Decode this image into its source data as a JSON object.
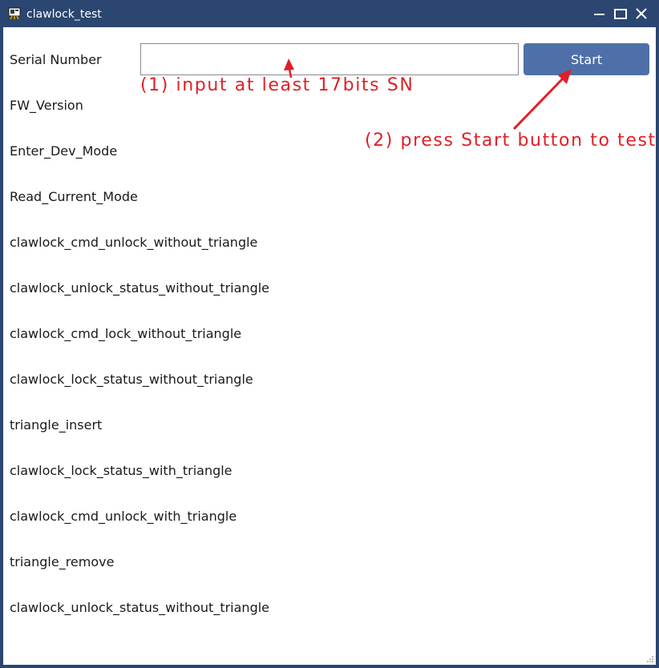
{
  "window": {
    "title": "clawlock_test",
    "icon": "app-icon",
    "controls": [
      "minimize-icon",
      "maximize-icon",
      "close-icon"
    ]
  },
  "form": {
    "serial_label": "Serial Number",
    "serial_value": "",
    "start_label": "Start"
  },
  "annotations": {
    "step1": "(1)  input  at  least  17bits  SN",
    "step2": "(2)  press  Start  button  to  test",
    "color": "#e11f26"
  },
  "test_items": [
    "FW_Version",
    "Enter_Dev_Mode",
    "Read_Current_Mode",
    "clawlock_cmd_unlock_without_triangle",
    "clawlock_unlock_status_without_triangle",
    "clawlock_cmd_lock_without_triangle",
    "clawlock_lock_status_without_triangle",
    "triangle_insert",
    "clawlock_lock_status_with_triangle",
    "clawlock_cmd_unlock_with_triangle",
    "triangle_remove",
    "clawlock_unlock_status_without_triangle"
  ],
  "colors": {
    "titlebar": "#2b4670",
    "button": "#4f6fa8"
  }
}
